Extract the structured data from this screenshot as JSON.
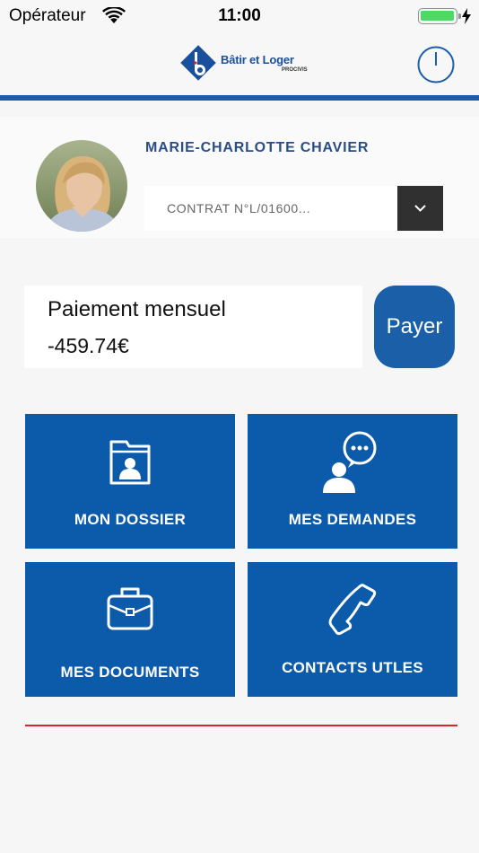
{
  "status_bar": {
    "carrier": "Opérateur",
    "time": "11:00",
    "battery_level": 1.0
  },
  "header": {
    "brand_name": "Bâtir et Loger",
    "brand_subline": "PROCIVIS",
    "icons": {
      "logo": "batir-et-loger-logo",
      "logout": "power-icon"
    }
  },
  "profile": {
    "name": "MARIE-CHARLOTTE CHAVIER",
    "contract": "CONTRAT N°L/01600...",
    "contract_dropdown_icon": "chevron-down-icon"
  },
  "payment": {
    "label": "Paiement mensuel",
    "amount": "-459.74€",
    "pay_button": "Payer"
  },
  "tiles": [
    {
      "label": "MON DOSSIER",
      "icon": "folder-person-icon"
    },
    {
      "label": "MES DEMANDES",
      "icon": "person-chat-icon"
    },
    {
      "label": "MES DOCUMENTS",
      "icon": "briefcase-icon"
    },
    {
      "label": "CONTACTS UTLES",
      "icon": "phone-icon"
    }
  ],
  "colors": {
    "primary_blue": "#0c5aaa",
    "header_blue": "#1a5fa8",
    "name_blue": "#2b4d86",
    "accent_red": "#d7262c",
    "dropdown_dark": "#303030"
  }
}
